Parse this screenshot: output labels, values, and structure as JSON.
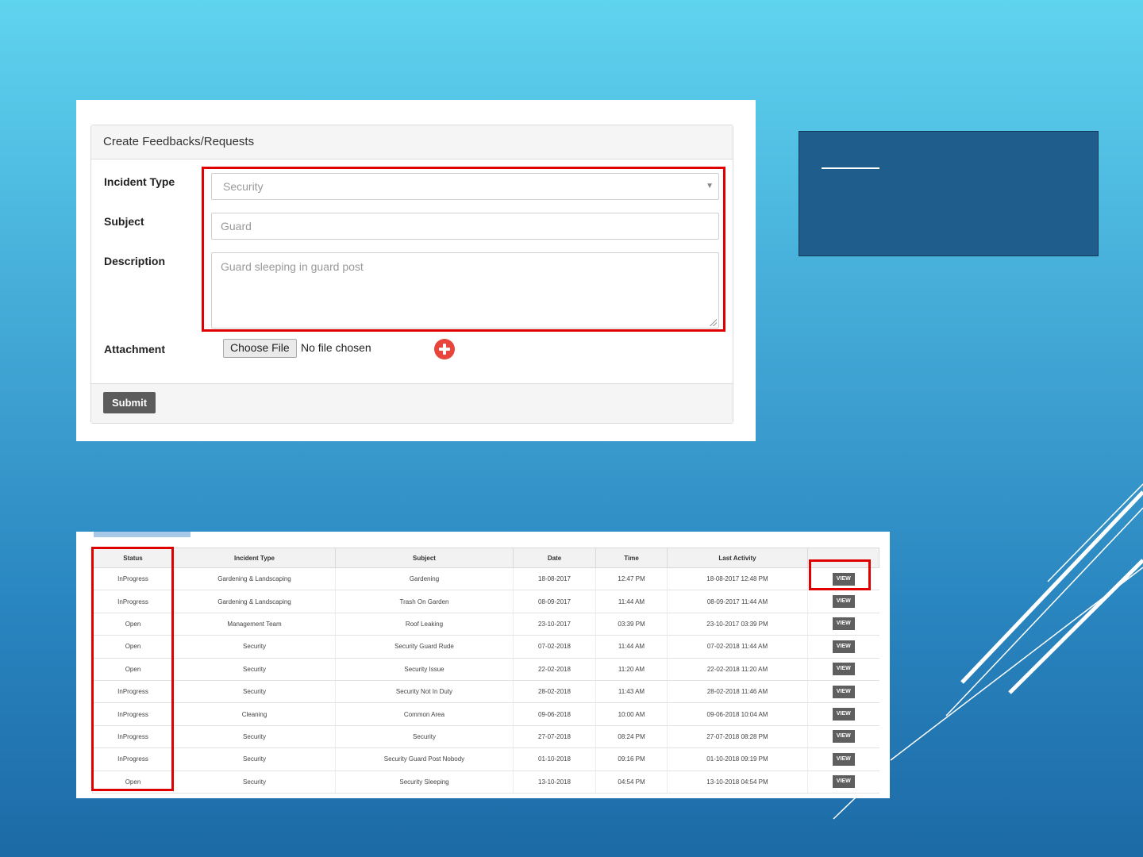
{
  "form": {
    "title": "Create Feedbacks/Requests",
    "labels": {
      "incident_type": "Incident Type",
      "subject": "Subject",
      "description": "Description",
      "attachment": "Attachment"
    },
    "incident_type_value": "Security",
    "subject_value": "Guard",
    "description_value": "Guard sleeping in guard post",
    "file_button": "Choose File",
    "file_status": "No file chosen",
    "submit": "Submit"
  },
  "table": {
    "headers": [
      "Status",
      "Incident Type",
      "Subject",
      "Date",
      "Time",
      "Last Activity",
      ""
    ],
    "view_label": "VIEW",
    "rows": [
      [
        "InProgress",
        "Gardening & Landscaping",
        "Gardening",
        "18-08-2017",
        "12:47 PM",
        "18-08-2017 12:48 PM"
      ],
      [
        "InProgress",
        "Gardening & Landscaping",
        "Trash On Garden",
        "08-09-2017",
        "11:44 AM",
        "08-09-2017 11:44 AM"
      ],
      [
        "Open",
        "Management Team",
        "Roof Leaking",
        "23-10-2017",
        "03:39 PM",
        "23-10-2017 03:39 PM"
      ],
      [
        "Open",
        "Security",
        "Security Guard Rude",
        "07-02-2018",
        "11:44 AM",
        "07-02-2018 11:44 AM"
      ],
      [
        "Open",
        "Security",
        "Security Issue",
        "22-02-2018",
        "11:20 AM",
        "22-02-2018 11:20 AM"
      ],
      [
        "InProgress",
        "Security",
        "Security Not In Duty",
        "28-02-2018",
        "11:43 AM",
        "28-02-2018 11:46 AM"
      ],
      [
        "InProgress",
        "Cleaning",
        "Common Area",
        "09-06-2018",
        "10:00 AM",
        "09-06-2018 10:04 AM"
      ],
      [
        "InProgress",
        "Security",
        "Security",
        "27-07-2018",
        "08:24 PM",
        "27-07-2018 08:28 PM"
      ],
      [
        "InProgress",
        "Security",
        "Security Guard Post Nobody",
        "01-10-2018",
        "09:16 PM",
        "01-10-2018 09:19 PM"
      ],
      [
        "Open",
        "Security",
        "Security Sleeping",
        "13-10-2018",
        "04:54 PM",
        "13-10-2018 04:54 PM"
      ]
    ]
  },
  "colors": {
    "highlight": "#e00000",
    "info_box": "#1f5e8c",
    "submit_button": "#5c5c5c",
    "add_icon": "#e8463c"
  },
  "icons": [
    "chevron-down-icon",
    "add-circle-icon",
    "resize-grip-icon"
  ]
}
